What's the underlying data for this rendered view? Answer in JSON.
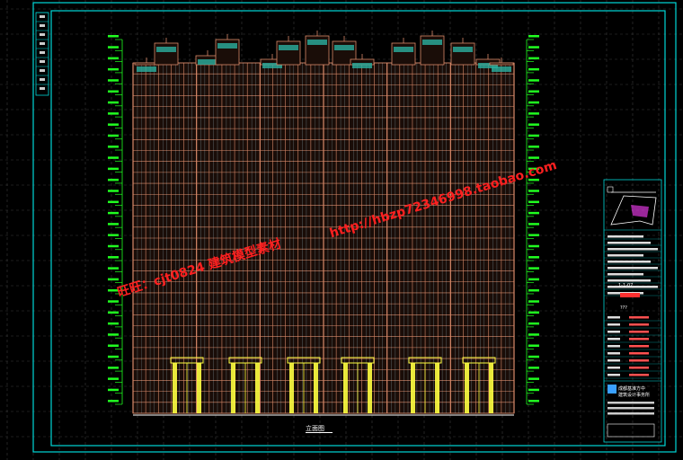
{
  "drawing": {
    "caption": "立面图",
    "watermarks": [
      "旺旺：cjt0824   建筑模型素材",
      "http://hbzp72346998.taobao.com"
    ],
    "title_block": {
      "project_label": "1-1-07",
      "sheet_label": "???",
      "company_name_cn": "成都基准方中",
      "company_name_cn_2": "建筑设计事务所"
    }
  },
  "building": {
    "floors": 32,
    "bays": 30
  },
  "colors": {
    "background": "#000000",
    "frame": "#00d7d7",
    "grid": "#3a3a3a",
    "facade": "#d98a6a",
    "glass": "#c0f0ff",
    "level_marks": "#20ff20",
    "podium": "#ffff40",
    "watermark": "#ff2020"
  }
}
